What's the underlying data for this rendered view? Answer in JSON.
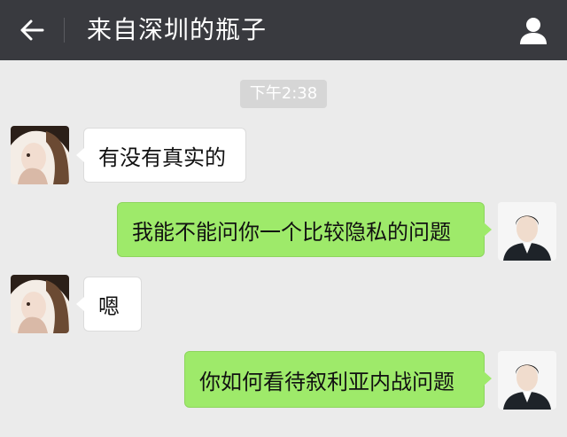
{
  "header": {
    "title": "来自深圳的瓶子",
    "back_icon": "back-arrow-icon",
    "profile_icon": "person-icon"
  },
  "timestamp": "下午2:38",
  "messages": [
    {
      "side": "left",
      "sender": "other",
      "text": "有没有真实的"
    },
    {
      "side": "right",
      "sender": "me",
      "text": "我能不能问你一个比较隐私的问题"
    },
    {
      "side": "left",
      "sender": "other",
      "text": "嗯"
    },
    {
      "side": "right",
      "sender": "me",
      "text": "你如何看待叙利亚内战问题"
    }
  ],
  "colors": {
    "topbar": "#393a3f",
    "background": "#ebebeb",
    "my_bubble": "#9eea6a",
    "their_bubble": "#ffffff"
  }
}
